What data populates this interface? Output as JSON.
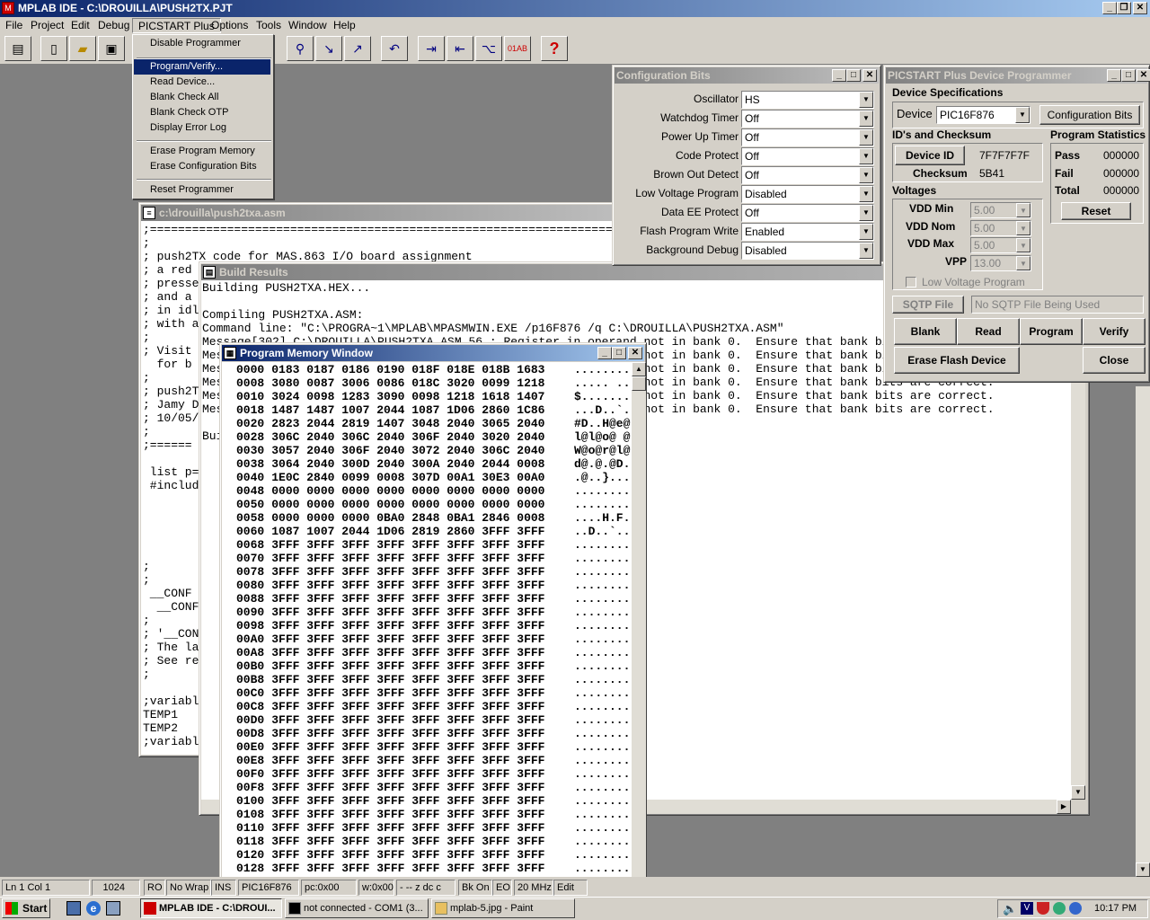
{
  "app": {
    "title": "MPLAB IDE - C:\\DROUILLA\\PUSH2TX.PJT",
    "controls": [
      "_",
      "❐",
      "✕"
    ]
  },
  "menubar": [
    "File",
    "Project",
    "Edit",
    "Debug",
    "PICSTART Plus",
    "Options",
    "Tools",
    "Window",
    "Help"
  ],
  "dropdown": {
    "items": [
      "Disable Programmer",
      "Program/Verify...",
      "Read Device...",
      "Blank Check All",
      "Blank Check OTP",
      "Display Error Log",
      "Erase Program Memory",
      "Erase Configuration Bits",
      "Reset Programmer"
    ],
    "selected": "Program/Verify..."
  },
  "asm": {
    "title": "c:\\drouilla\\push2txa.asm",
    "lines": [
      ";=======================================================================",
      ";",
      "; push2TX code for MAS.863 I/O board assignment",
      "; a red",
      "; presse",
      "; and a",
      "; in idl",
      "; with a",
      ";",
      "; Visit",
      "  for b",
      ";",
      "; push2T",
      "; Jamy D",
      "; 10/05/",
      ";",
      ";======",
      "",
      " list p=",
      " #includ",
      "",
      "",
      "",
      "",
      "",
      ";",
      ";",
      " __CONF",
      "  __CONF",
      ";",
      "; '__CON",
      "; The la",
      "; See re",
      ";",
      "",
      ";variabl",
      "TEMP1",
      "TEMP2",
      ";variabl"
    ]
  },
  "build": {
    "title": "Build Results",
    "lines": [
      "Building PUSH2TXA.HEX...",
      "",
      "Compiling PUSH2TXA.ASM:",
      "Command line: \"C:\\PROGRA~1\\MPLAB\\MPASMWIN.EXE /p16F876 /q C:\\DROUILLA\\PUSH2TXA.ASM\"",
      "Message[302] C:\\DROUILLA\\PUSH2TXA.ASM 56 : Register in operand not in bank 0.  Ensure that bank bits are correct.",
      "Message[302] C:\\DROUILLA\\PUSH2TXA.ASM 57 : Register in operand not in bank 0.  Ensure that bank bits are correct.",
      "Message[302] C:\\DROUILLA\\PUSH2TXA.ASM 58 : Register in operand not in bank 0.  Ensure that bank bits are correct.",
      "Message[302] C:\\DROUILLA\\PUSH2TXA.ASM 59 : Register in operand not in bank 0.  Ensure that bank bits are correct.",
      "Message[302] C:\\DROUILLA\\PUSH2TXA.ASM 60 : Register in operand not in bank 0.  Ensure that bank bits are correct.",
      "Message[302] C:\\DROUILLA\\PUSH2TXA.ASM 61 : Register in operand not in bank 0.  Ensure that bank bits are correct.",
      "",
      "Build completed successfully."
    ]
  },
  "pmem": {
    "title": "Program Memory Window",
    "rows": [
      [
        "0000",
        "0183 0187 0186 0190 018F 018E 018B 1683",
        "........"
      ],
      [
        "0008",
        "3080 0087 3006 0086 018C 3020 0099 1218",
        "..... .."
      ],
      [
        "0010",
        "3024 0098 1283 3090 0098 1218 1618 1407",
        "$......."
      ],
      [
        "0018",
        "1487 1487 1007 2044 1087 1D06 2860 1C86",
        "...D..`."
      ],
      [
        "0020",
        "2823 2044 2819 1407 3048 2040 3065 2040",
        "#D..H@e@"
      ],
      [
        "0028",
        "306C 2040 306C 2040 306F 2040 3020 2040",
        "l@l@o@ @"
      ],
      [
        "0030",
        "3057 2040 306F 2040 3072 2040 306C 2040",
        "W@o@r@l@"
      ],
      [
        "0038",
        "3064 2040 300D 2040 300A 2040 2044 0008",
        "d@.@.@D."
      ],
      [
        "0040",
        "1E0C 2840 0099 0008 307D 00A1 30E3 00A0",
        ".@..}..."
      ],
      [
        "0048",
        "0000 0000 0000 0000 0000 0000 0000 0000",
        "........"
      ],
      [
        "0050",
        "0000 0000 0000 0000 0000 0000 0000 0000",
        "........"
      ],
      [
        "0058",
        "0000 0000 0000 0BA0 2848 0BA1 2846 0008",
        "....H.F."
      ],
      [
        "0060",
        "1087 1007 2044 1D06 2819 2860 3FFF 3FFF",
        "..D..`.."
      ],
      [
        "0068",
        "3FFF 3FFF 3FFF 3FFF 3FFF 3FFF 3FFF 3FFF",
        "........"
      ],
      [
        "0070",
        "3FFF 3FFF 3FFF 3FFF 3FFF 3FFF 3FFF 3FFF",
        "........"
      ],
      [
        "0078",
        "3FFF 3FFF 3FFF 3FFF 3FFF 3FFF 3FFF 3FFF",
        "........"
      ],
      [
        "0080",
        "3FFF 3FFF 3FFF 3FFF 3FFF 3FFF 3FFF 3FFF",
        "........"
      ],
      [
        "0088",
        "3FFF 3FFF 3FFF 3FFF 3FFF 3FFF 3FFF 3FFF",
        "........"
      ],
      [
        "0090",
        "3FFF 3FFF 3FFF 3FFF 3FFF 3FFF 3FFF 3FFF",
        "........"
      ],
      [
        "0098",
        "3FFF 3FFF 3FFF 3FFF 3FFF 3FFF 3FFF 3FFF",
        "........"
      ],
      [
        "00A0",
        "3FFF 3FFF 3FFF 3FFF 3FFF 3FFF 3FFF 3FFF",
        "........"
      ],
      [
        "00A8",
        "3FFF 3FFF 3FFF 3FFF 3FFF 3FFF 3FFF 3FFF",
        "........"
      ],
      [
        "00B0",
        "3FFF 3FFF 3FFF 3FFF 3FFF 3FFF 3FFF 3FFF",
        "........"
      ],
      [
        "00B8",
        "3FFF 3FFF 3FFF 3FFF 3FFF 3FFF 3FFF 3FFF",
        "........"
      ],
      [
        "00C0",
        "3FFF 3FFF 3FFF 3FFF 3FFF 3FFF 3FFF 3FFF",
        "........"
      ],
      [
        "00C8",
        "3FFF 3FFF 3FFF 3FFF 3FFF 3FFF 3FFF 3FFF",
        "........"
      ],
      [
        "00D0",
        "3FFF 3FFF 3FFF 3FFF 3FFF 3FFF 3FFF 3FFF",
        "........"
      ],
      [
        "00D8",
        "3FFF 3FFF 3FFF 3FFF 3FFF 3FFF 3FFF 3FFF",
        "........"
      ],
      [
        "00E0",
        "3FFF 3FFF 3FFF 3FFF 3FFF 3FFF 3FFF 3FFF",
        "........"
      ],
      [
        "00E8",
        "3FFF 3FFF 3FFF 3FFF 3FFF 3FFF 3FFF 3FFF",
        "........"
      ],
      [
        "00F0",
        "3FFF 3FFF 3FFF 3FFF 3FFF 3FFF 3FFF 3FFF",
        "........"
      ],
      [
        "00F8",
        "3FFF 3FFF 3FFF 3FFF 3FFF 3FFF 3FFF 3FFF",
        "........"
      ],
      [
        "0100",
        "3FFF 3FFF 3FFF 3FFF 3FFF 3FFF 3FFF 3FFF",
        "........"
      ],
      [
        "0108",
        "3FFF 3FFF 3FFF 3FFF 3FFF 3FFF 3FFF 3FFF",
        "........"
      ],
      [
        "0110",
        "3FFF 3FFF 3FFF 3FFF 3FFF 3FFF 3FFF 3FFF",
        "........"
      ],
      [
        "0118",
        "3FFF 3FFF 3FFF 3FFF 3FFF 3FFF 3FFF 3FFF",
        "........"
      ],
      [
        "0120",
        "3FFF 3FFF 3FFF 3FFF 3FFF 3FFF 3FFF 3FFF",
        "........"
      ],
      [
        "0128",
        "3FFF 3FFF 3FFF 3FFF 3FFF 3FFF 3FFF 3FFF",
        "........"
      ]
    ]
  },
  "config": {
    "title": "Configuration Bits",
    "rows": [
      {
        "label": "Oscillator",
        "value": "HS"
      },
      {
        "label": "Watchdog Timer",
        "value": "Off"
      },
      {
        "label": "Power Up Timer",
        "value": "Off"
      },
      {
        "label": "Code Protect",
        "value": "Off"
      },
      {
        "label": "Brown Out Detect",
        "value": "Off"
      },
      {
        "label": "Low Voltage Program",
        "value": "Disabled"
      },
      {
        "label": "Data EE Protect",
        "value": "Off"
      },
      {
        "label": "Flash Program Write",
        "value": "Enabled"
      },
      {
        "label": "Background Debug",
        "value": "Disabled"
      }
    ]
  },
  "prog": {
    "title": "PICSTART Plus Device Programmer",
    "device_spec": "Device Specifications",
    "device_label": "Device",
    "device_value": "PIC16F876",
    "config_bits_btn": "Configuration Bits",
    "ids_group": "ID's and Checksum",
    "device_id_btn": "Device ID",
    "device_id_value": "7F7F7F7F",
    "checksum_label": "Checksum",
    "checksum_value": "5B41",
    "stats_group": "Program Statistics",
    "pass_label": "Pass",
    "pass_value": "000000",
    "fail_label": "Fail",
    "fail_value": "000000",
    "total_label": "Total",
    "total_value": "000000",
    "reset_btn": "Reset",
    "voltages_group": "Voltages",
    "vdd_min_label": "VDD Min",
    "vdd_min": "5.00",
    "vdd_nom_label": "VDD Nom",
    "vdd_nom": "5.00",
    "vdd_max_label": "VDD Max",
    "vdd_max": "5.00",
    "vpp_label": "VPP",
    "vpp": "13.00",
    "low_voltage_label": "Low Voltage Program",
    "sqtp_btn": "SQTP File",
    "sqtp_value": "No SQTP File Being Used",
    "blank_btn": "Blank",
    "read_btn": "Read",
    "program_btn": "Program",
    "verify_btn": "Verify",
    "erase_btn": "Erase Flash Device",
    "close_btn": "Close"
  },
  "status": [
    "Ln 1 Col 1",
    "1024",
    "RO",
    "No Wrap",
    "INS",
    "PIC16F876",
    "pc:0x00",
    "w:0x00",
    "- -- z dc c",
    "Bk On",
    "EO",
    "20 MHz",
    "Edit"
  ],
  "taskbar": {
    "start": "Start",
    "tasks": [
      "MPLAB IDE - C:\\DROUI...",
      "not connected - COM1 (3...",
      "mplab-5.jpg - Paint"
    ],
    "clock": "10:17 PM"
  },
  "colors": {
    "titlebar": "#0a246a",
    "face": "#d4d0c8",
    "desktop": "#808080",
    "highlight": "#0a246a"
  }
}
